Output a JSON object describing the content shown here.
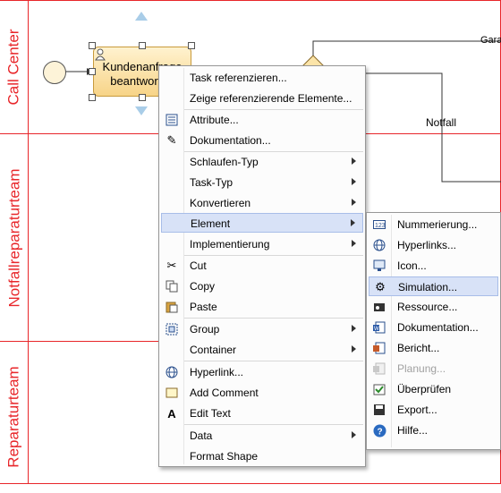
{
  "lanes": [
    {
      "label": "Call Center"
    },
    {
      "label": "Notfallreparaturteam"
    },
    {
      "label": "Reparaturteam"
    }
  ],
  "diagram": {
    "task_label": "Kundenanfrage beantworten",
    "edge_label_garantie": "Gara",
    "edge_label_notfall": "Notfall"
  },
  "context_menu": {
    "items": [
      {
        "label": "Task referenzieren...",
        "icon": "none"
      },
      {
        "label": "Zeige referenzierende Elemente...",
        "icon": "none"
      },
      {
        "label": "Attribute...",
        "icon": "attributes-icon"
      },
      {
        "label": "Dokumentation...",
        "icon": "pencil-icon"
      },
      {
        "label": "Schlaufen-Typ",
        "icon": "none"
      },
      {
        "label": "Task-Typ",
        "icon": "none"
      },
      {
        "label": "Konvertieren",
        "icon": "none"
      },
      {
        "label": "Element",
        "icon": "none"
      },
      {
        "label": "Implementierung",
        "icon": "none"
      },
      {
        "label": "Cut",
        "icon": "scissors-icon"
      },
      {
        "label": "Copy",
        "icon": "copy-icon"
      },
      {
        "label": "Paste",
        "icon": "paste-icon"
      },
      {
        "label": "Group",
        "icon": "group-icon"
      },
      {
        "label": "Container",
        "icon": "none"
      },
      {
        "label": "Hyperlink...",
        "icon": "hyperlink-icon"
      },
      {
        "label": "Add Comment",
        "icon": "comment-icon"
      },
      {
        "label": "Edit Text",
        "icon": "text-icon"
      },
      {
        "label": "Data",
        "icon": "none"
      },
      {
        "label": "Format Shape",
        "icon": "none"
      }
    ]
  },
  "submenu": {
    "items": [
      {
        "label": "Nummerierung...",
        "icon": "numbering-icon"
      },
      {
        "label": "Hyperlinks...",
        "icon": "hyperlinks-icon"
      },
      {
        "label": "Icon...",
        "icon": "icon-picker-icon"
      },
      {
        "label": "Simulation...",
        "icon": "simulation-gear-icon"
      },
      {
        "label": "Ressource...",
        "icon": "resource-icon"
      },
      {
        "label": "Dokumentation...",
        "icon": "word-document-icon"
      },
      {
        "label": "Bericht...",
        "icon": "report-icon"
      },
      {
        "label": "Planung...",
        "icon": "planning-icon"
      },
      {
        "label": "Überprüfen",
        "icon": "check-icon"
      },
      {
        "label": "Export...",
        "icon": "export-icon"
      },
      {
        "label": "Hilfe...",
        "icon": "help-icon"
      }
    ]
  }
}
